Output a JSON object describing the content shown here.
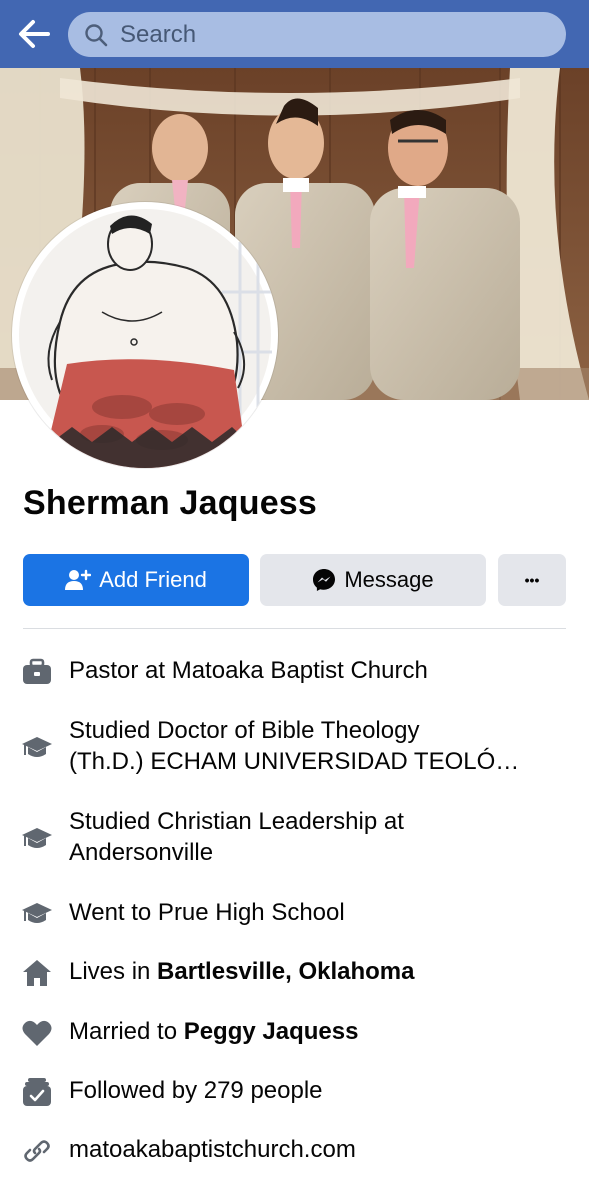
{
  "header": {
    "search_placeholder": "Search"
  },
  "profile": {
    "name": "Sherman Jaquess"
  },
  "actions": {
    "add_friend": "Add Friend",
    "message": "Message",
    "more": "•••"
  },
  "details": {
    "work": "Pastor at Matoaka Baptist Church",
    "edu1_line1": "Studied Doctor of Bible Theology",
    "edu1_line2": "(Th.D.) ECHAM UNIVERSIDAD TEOLÓ…",
    "edu2_line1": "Studied Christian Leadership at",
    "edu2_line2": "Andersonville",
    "edu3": "Went to Prue High School",
    "lives_prefix": "Lives in ",
    "lives_place": "Bartlesville, Oklahoma",
    "married_prefix": "Married to ",
    "married_name": "Peggy Jaquess",
    "followers": "Followed by 279 people",
    "website": "matoakabaptistchurch.com"
  },
  "colors": {
    "header_bg": "#4267b2",
    "primary_button": "#1b74e4",
    "secondary_button": "#e4e6eb",
    "icon_gray": "#606770"
  },
  "icons": {
    "back": "arrow-left-icon",
    "search": "search-icon",
    "add_friend": "add-friend-icon",
    "message": "messenger-icon",
    "work": "briefcase-icon",
    "education": "graduation-cap-icon",
    "home": "home-icon",
    "relationship": "heart-icon",
    "followers": "followers-icon",
    "website": "link-icon"
  }
}
